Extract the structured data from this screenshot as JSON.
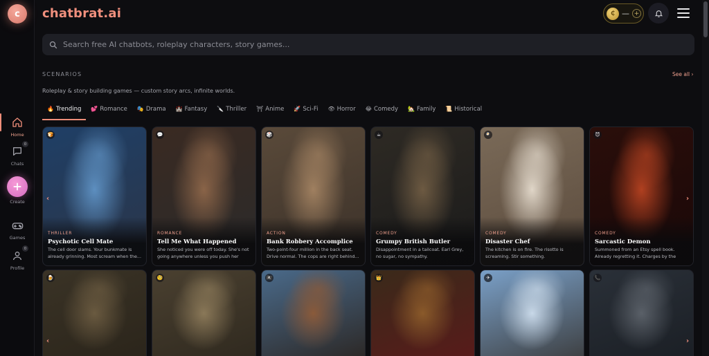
{
  "brand": {
    "avatar_letter": "c",
    "name": "chatbrat.ai"
  },
  "header": {
    "coins_value": "—",
    "coin_glyph": "₵"
  },
  "search": {
    "placeholder": "Search free AI chatbots, roleplay characters, story games..."
  },
  "sidebar": {
    "items": [
      {
        "label": "Home",
        "icon": "home-icon",
        "active": true
      },
      {
        "label": "Chats",
        "icon": "chat-icon",
        "badge": "0"
      },
      {
        "label": "Create",
        "icon": "plus-icon"
      },
      {
        "label": "Games",
        "icon": "gamepad-icon"
      },
      {
        "label": "Profile",
        "icon": "user-icon",
        "badge": "0"
      }
    ]
  },
  "section": {
    "title": "SCENARIOS",
    "see_all": "See all ›",
    "description": "Roleplay & story building games — custom story arcs, infinite worlds."
  },
  "tabs": [
    {
      "emoji": "🔥",
      "label": "Trending",
      "active": true
    },
    {
      "emoji": "💕",
      "label": "Romance"
    },
    {
      "emoji": "🎭",
      "label": "Drama"
    },
    {
      "emoji": "🏰",
      "label": "Fantasy"
    },
    {
      "emoji": "🔪",
      "label": "Thriller"
    },
    {
      "emoji": "⛩",
      "label": "Anime"
    },
    {
      "emoji": "🚀",
      "label": "Sci-Fi"
    },
    {
      "emoji": "👁",
      "label": "Horror"
    },
    {
      "emoji": "😂",
      "label": "Comedy"
    },
    {
      "emoji": "🏡",
      "label": "Family"
    },
    {
      "emoji": "📜",
      "label": "Historical"
    }
  ],
  "cards": [
    {
      "tag": "🍞",
      "category": "THRILLER",
      "title": "Psychotic Cell Mate",
      "blurb": "The cell door slams. Your bunkmate is already grinning. Most scream when the...",
      "palette": [
        "#1f3f66",
        "#5d8fc0",
        "#2b3548"
      ]
    },
    {
      "tag": "💬",
      "category": "ROMANCE",
      "title": "Tell Me What Happened",
      "blurb": "She noticed you were off today. She's not going anywhere unless you push her away.",
      "palette": [
        "#3a2a22",
        "#8a6448",
        "#2a2a2a"
      ]
    },
    {
      "tag": "🎲",
      "category": "ACTION",
      "title": "Bank Robbery Accomplice",
      "blurb": "Two-point-four million in the back seat. Drive normal. The cops are right behind...",
      "palette": [
        "#5a4a3a",
        "#a08060",
        "#3a3028"
      ]
    },
    {
      "tag": "☕",
      "category": "COMEDY",
      "title": "Grumpy British Butler",
      "blurb": "Disappointment in a tailcoat. Earl Grey, no sugar, no sympathy.",
      "palette": [
        "#2e2a24",
        "#6d5a42",
        "#1a1a1a"
      ]
    },
    {
      "tag": "🍳",
      "category": "COMEDY",
      "title": "Disaster Chef",
      "blurb": "The kitchen is on fire. The risotto is screaming. Stir something.",
      "palette": [
        "#7a6a58",
        "#e0d6c8",
        "#5a4a3c"
      ]
    },
    {
      "tag": "😈",
      "category": "COMEDY",
      "title": "Sarcastic Demon",
      "blurb": "Summoned from an Etsy spell book. Already regretting it. Charges by the hour.",
      "palette": [
        "#2a0e0a",
        "#b04020",
        "#1a0808"
      ]
    },
    {
      "tag": "🍺",
      "category": "",
      "title": "",
      "blurb": "",
      "palette": [
        "#3a3326",
        "#6a5a40",
        "#2a241a"
      ]
    },
    {
      "tag": "🧐",
      "category": "",
      "title": "",
      "blurb": "",
      "palette": [
        "#4a4030",
        "#8a7858",
        "#2e281e"
      ]
    },
    {
      "tag": "🏴‍☠️",
      "category": "",
      "title": "",
      "blurb": "",
      "palette": [
        "#4a6a8a",
        "#8a5a3a",
        "#2a2420"
      ]
    },
    {
      "tag": "👑",
      "category": "",
      "title": "",
      "blurb": "",
      "palette": [
        "#3a2a1a",
        "#8a5a2a",
        "#5a1a1a"
      ]
    },
    {
      "tag": "✈",
      "category": "",
      "title": "",
      "blurb": "",
      "palette": [
        "#7aa0c8",
        "#c8d8e8",
        "#3a3a3a"
      ]
    },
    {
      "tag": "📞",
      "category": "",
      "title": "",
      "blurb": "",
      "palette": [
        "#2a3038",
        "#5a6068",
        "#1a1e24"
      ]
    }
  ],
  "carousel": {
    "prev": "‹",
    "next": "›"
  }
}
